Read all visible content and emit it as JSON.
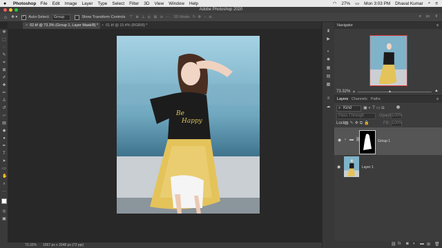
{
  "menubar": {
    "app": "Photoshop",
    "items": [
      "File",
      "Edit",
      "Image",
      "Layer",
      "Type",
      "Select",
      "Filter",
      "3D",
      "View",
      "Window",
      "Help"
    ],
    "battery": "27%",
    "clock": "Mon 3:03 PM",
    "user": "Dhaval Kumar"
  },
  "titlebar": {
    "title": "Adobe Photoshop 2020"
  },
  "options": {
    "auto_select_label": "Auto-Select:",
    "auto_select_value": "Group",
    "transform_label": "Show Transform Controls",
    "mode_3d": "3D Mode:"
  },
  "tabs": [
    {
      "label": "02.tif @ 73.3% (Group 1, Layer Mask/8) *"
    },
    {
      "label": "01.tif @ 15.4% (RGB/8) *"
    }
  ],
  "navigator": {
    "title": "Navigator",
    "zoom": "73.32%"
  },
  "layers_panel": {
    "tabs": [
      "Layers",
      "Channels",
      "Paths"
    ],
    "filter_kind": "Kind",
    "blend_mode": "Pass Through",
    "opacity_label": "Opacity:",
    "opacity_value": "100%",
    "lock_label": "Lock:",
    "fill_label": "Fill:",
    "fill_value": "100%",
    "layers": [
      {
        "name": "Group 1"
      },
      {
        "name": "Layer 1"
      }
    ]
  },
  "status": {
    "zoom": "73.32%",
    "doc_info": "1567 px x 2048 px (72 ppi)"
  }
}
